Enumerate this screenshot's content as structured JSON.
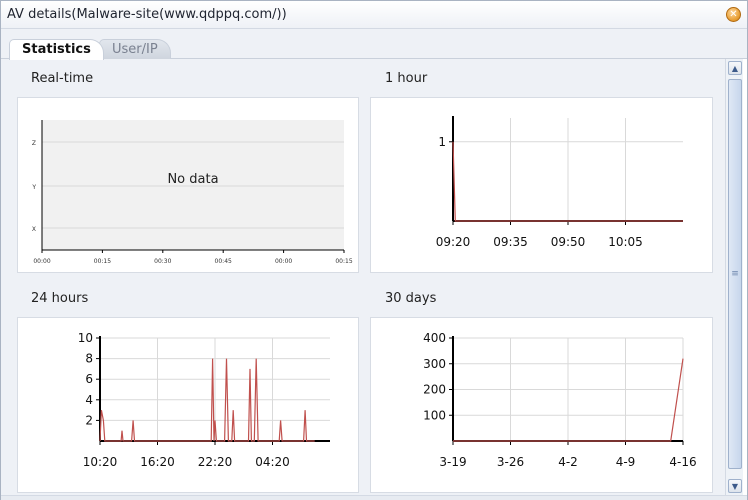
{
  "window": {
    "title": "AV details(Malware-site(www.qdppq.com/))",
    "close_icon": "close-icon",
    "accent_color": "#e69a2c"
  },
  "tabs": [
    {
      "label": "Statistics",
      "active": true
    },
    {
      "label": "User/IP",
      "active": false
    }
  ],
  "sections": {
    "realtime": "Real-time",
    "hour": "1 hour",
    "day": "24 hours",
    "month": "30 days"
  },
  "chart_data": [
    {
      "id": "realtime",
      "type": "line",
      "empty_message": "No data",
      "y_ticks": [
        "X",
        "Y",
        "Z"
      ],
      "x_ticks": [
        "00:00",
        "00:15",
        "00:30",
        "00:45",
        "00:00",
        "00:15"
      ],
      "series": []
    },
    {
      "id": "hour",
      "type": "line",
      "xlim": [
        0,
        60
      ],
      "ylim": [
        0,
        1.3
      ],
      "y_ticks": [
        {
          "label": "1",
          "value": 1
        }
      ],
      "x_ticks": [
        {
          "label": "09:20",
          "value": 0
        },
        {
          "label": "09:35",
          "value": 15
        },
        {
          "label": "09:50",
          "value": 30
        },
        {
          "label": "10:05",
          "value": 45
        }
      ],
      "series": [
        {
          "values": [
            [
              0,
              1
            ],
            [
              0.6,
              0
            ],
            [
              60,
              0
            ]
          ]
        }
      ]
    },
    {
      "id": "day",
      "type": "line",
      "xlim": [
        0,
        24
      ],
      "ylim": [
        0,
        10
      ],
      "y_ticks": [
        {
          "label": "2",
          "value": 2
        },
        {
          "label": "4",
          "value": 4
        },
        {
          "label": "6",
          "value": 6
        },
        {
          "label": "8",
          "value": 8
        },
        {
          "label": "10",
          "value": 10
        }
      ],
      "x_ticks": [
        {
          "label": "10:20",
          "value": 0
        },
        {
          "label": "16:20",
          "value": 6
        },
        {
          "label": "22:20",
          "value": 12
        },
        {
          "label": "04:20",
          "value": 18
        }
      ],
      "series": [
        {
          "values": [
            [
              0,
              0
            ],
            [
              0.15,
              3
            ],
            [
              0.35,
              2
            ],
            [
              0.5,
              0
            ],
            [
              2.2,
              0
            ],
            [
              2.3,
              1
            ],
            [
              2.4,
              0
            ],
            [
              3.3,
              0
            ],
            [
              3.45,
              2
            ],
            [
              3.6,
              0
            ],
            [
              11.6,
              0
            ],
            [
              11.75,
              8
            ],
            [
              11.9,
              0
            ],
            [
              12.0,
              2
            ],
            [
              12.15,
              0
            ],
            [
              13.0,
              0
            ],
            [
              13.2,
              8
            ],
            [
              13.4,
              0
            ],
            [
              13.75,
              0
            ],
            [
              13.9,
              3
            ],
            [
              14.05,
              0
            ],
            [
              15.5,
              0
            ],
            [
              15.65,
              7
            ],
            [
              15.8,
              0
            ],
            [
              16.1,
              0
            ],
            [
              16.3,
              8
            ],
            [
              16.5,
              0
            ],
            [
              18.7,
              0
            ],
            [
              18.85,
              2
            ],
            [
              19.0,
              0
            ],
            [
              21.25,
              0
            ],
            [
              21.4,
              3
            ],
            [
              21.55,
              0
            ],
            [
              22.4,
              0
            ]
          ]
        }
      ]
    },
    {
      "id": "month",
      "type": "line",
      "xlim": [
        0,
        28
      ],
      "ylim": [
        0,
        400
      ],
      "y_ticks": [
        {
          "label": "100",
          "value": 100
        },
        {
          "label": "200",
          "value": 200
        },
        {
          "label": "300",
          "value": 300
        },
        {
          "label": "400",
          "value": 400
        }
      ],
      "x_ticks": [
        {
          "label": "3-19",
          "value": 0
        },
        {
          "label": "3-26",
          "value": 7
        },
        {
          "label": "4-2",
          "value": 14
        },
        {
          "label": "4-9",
          "value": 21
        },
        {
          "label": "4-16",
          "value": 28
        }
      ],
      "series": [
        {
          "values": [
            [
              0,
              0
            ],
            [
              26.5,
              0
            ],
            [
              28.8,
              320
            ]
          ]
        }
      ]
    }
  ]
}
